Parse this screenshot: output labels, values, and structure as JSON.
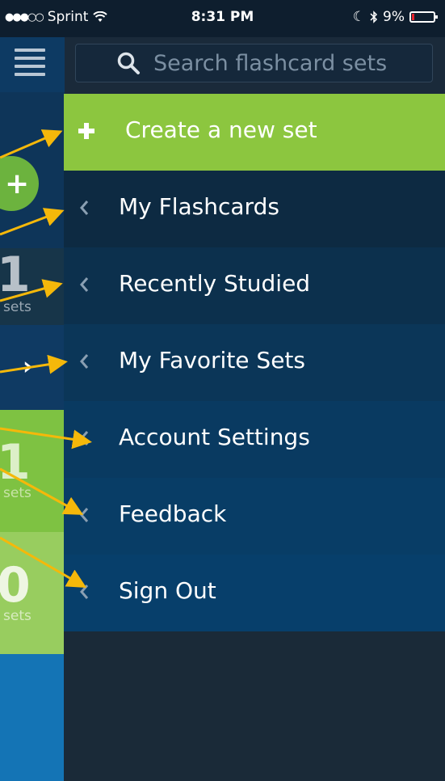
{
  "status_bar": {
    "signal_dots": "●●●○○",
    "carrier": "Sprint",
    "time": "8:31 PM",
    "battery_percent": "9%",
    "battery_level": 9
  },
  "search": {
    "placeholder": "Search flashcard sets"
  },
  "menu": {
    "create_label": "Create a new set",
    "items": [
      {
        "label": "My Flashcards"
      },
      {
        "label": "Recently Studied"
      },
      {
        "label": "My Favorite Sets"
      },
      {
        "label": "Account Settings"
      },
      {
        "label": "Feedback"
      },
      {
        "label": "Sign Out"
      }
    ]
  },
  "background_panel": {
    "counts": [
      "1",
      "1",
      "0"
    ],
    "unit_label": "sets"
  },
  "colors": {
    "create_green": "#8cc63f",
    "accent_green": "#6cb33e",
    "annotation_arrow": "#f5b80a",
    "menu_blue": "#073c66"
  }
}
